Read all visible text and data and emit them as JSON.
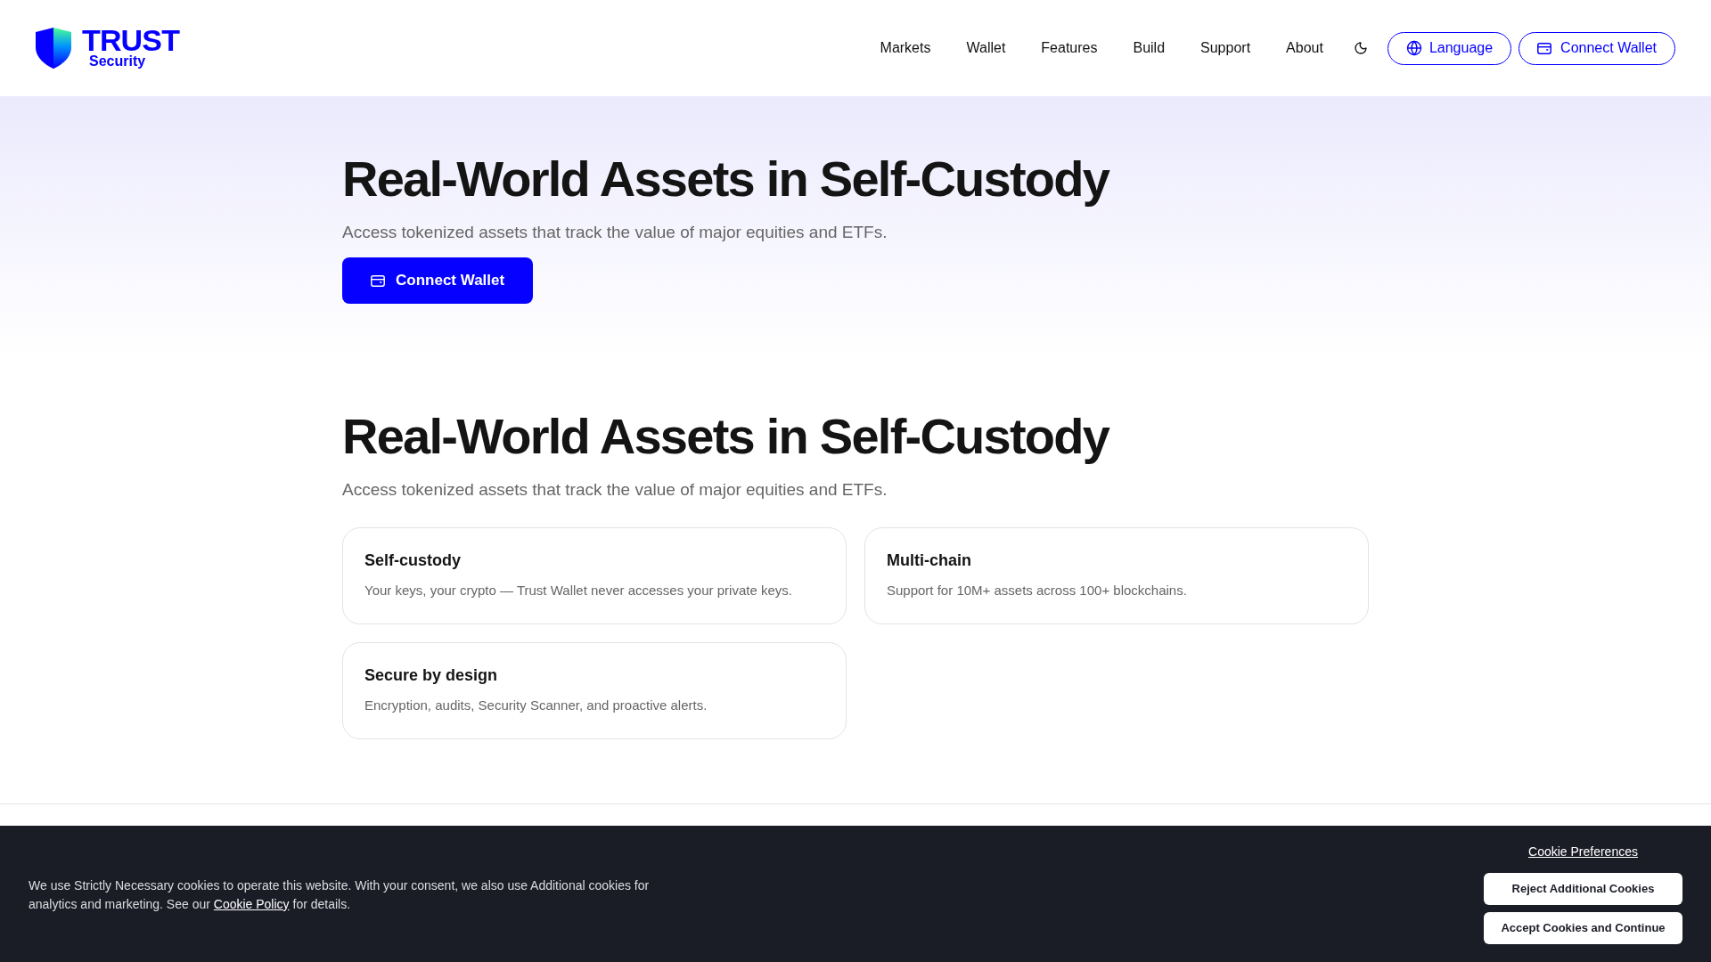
{
  "header": {
    "logo": {
      "wordmark": "TRUST",
      "tagline": "Security"
    },
    "nav": [
      "Markets",
      "Wallet",
      "Features",
      "Build",
      "Support",
      "About"
    ],
    "language_button": "Language",
    "connect_button": "Connect Wallet"
  },
  "hero": {
    "title": "Real-World Assets in Self-Custody",
    "subtitle": "Access tokenized assets that track the value of major equities and ETFs.",
    "button": "Connect Wallet"
  },
  "features": {
    "title": "Real-World Assets in Self-Custody",
    "subtitle": "Access tokenized assets that track the value of major equities and ETFs.",
    "cards": [
      {
        "title": "Self-custody",
        "description": "Your keys, your crypto — Trust Wallet never accesses your private keys."
      },
      {
        "title": "Multi-chain",
        "description": "Support for 10M+ assets across 100+ blockchains."
      },
      {
        "title": "Secure by design",
        "description": "Encryption, audits, Security Scanner, and proactive alerts."
      }
    ]
  },
  "cookie_banner": {
    "message_start": "We use Strictly Necessary cookies to operate this website. With your consent, we also use Additional cookies for analytics and marketing. See our",
    "link": "Cookie Policy",
    "message_end": "for details.",
    "preferences_link": "Cookie Preferences",
    "buttons": [
      "Reject Additional Cookies",
      "Accept Cookies and Continue"
    ]
  }
}
